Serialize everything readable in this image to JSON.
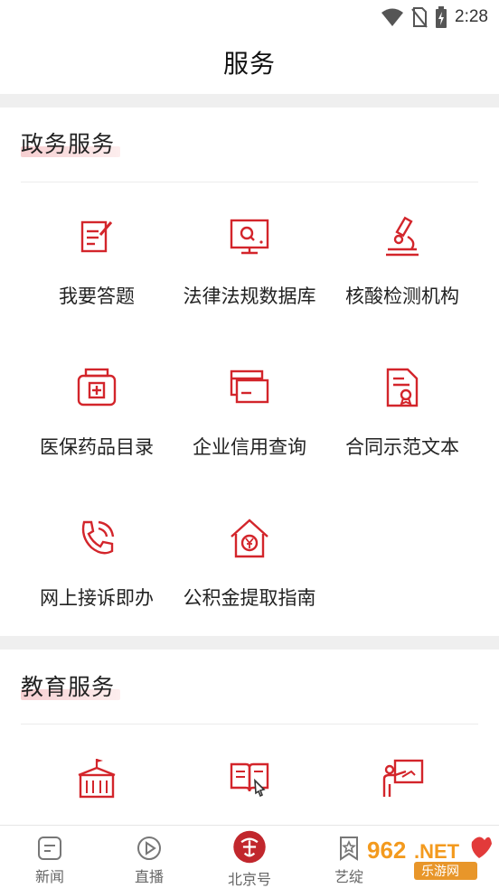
{
  "status_bar": {
    "time": "2:28",
    "icons": [
      "wifi-icon",
      "no-sim-icon",
      "battery-charging-icon"
    ]
  },
  "header": {
    "title": "服务"
  },
  "sections": [
    {
      "title": "政务服务",
      "items": [
        {
          "label": "我要答题",
          "icon": "edit-note-icon"
        },
        {
          "label": "法律法规数据库",
          "icon": "monitor-search-icon"
        },
        {
          "label": "核酸检测机构",
          "icon": "microscope-icon"
        },
        {
          "label": "医保药品目录",
          "icon": "medicine-box-icon"
        },
        {
          "label": "企业信用查询",
          "icon": "credit-card-icon"
        },
        {
          "label": "合同示范文本",
          "icon": "contract-document-icon"
        },
        {
          "label": "网上接诉即办",
          "icon": "phone-call-icon"
        },
        {
          "label": "公积金提取指南",
          "icon": "house-yuan-icon"
        }
      ]
    },
    {
      "title": "教育服务",
      "items": [
        {
          "icon": "school-building-icon"
        },
        {
          "icon": "open-book-icon"
        },
        {
          "icon": "teacher-board-icon"
        }
      ]
    }
  ],
  "bottom_nav": {
    "items": [
      {
        "label": "新闻",
        "icon": "news-icon"
      },
      {
        "label": "直播",
        "icon": "play-icon"
      },
      {
        "label": "北京号",
        "icon": "beijing-logo-icon"
      },
      {
        "label": "艺绽",
        "icon": "bookmark-star-icon"
      }
    ]
  },
  "watermark": {
    "brand": "962.NET",
    "subtitle": "乐游网"
  },
  "colors": {
    "accent": "#d3252b",
    "section_band": "#efefef",
    "text": "#222222"
  }
}
